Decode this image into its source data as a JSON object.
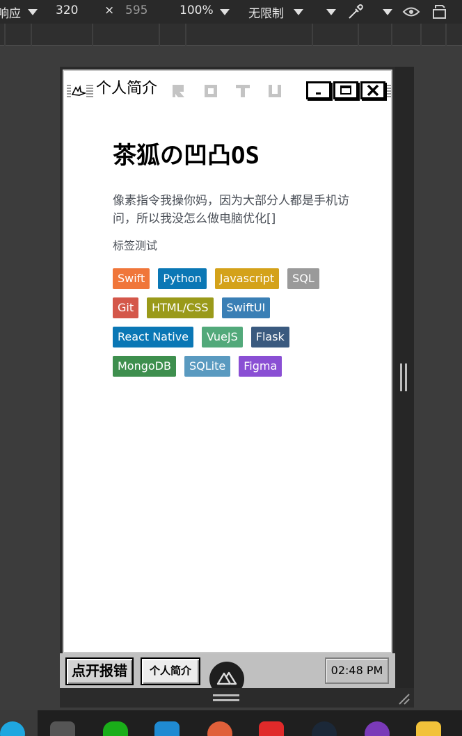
{
  "devtools": {
    "responsive_label": "响应",
    "width": "320",
    "times": "×",
    "height": "595",
    "zoom": "100%",
    "throttle": "无限制"
  },
  "window": {
    "title": "个人简介",
    "ghost_icons": [
      "R",
      "O",
      "T",
      "U"
    ]
  },
  "content": {
    "heading": "茶狐の凹凸OS",
    "description": "像素指令我操你妈，因为大部分人都是手机访问，所以我没怎么做电脑优化[]",
    "tags_label": "标签测试",
    "tags": [
      {
        "label": "Swift",
        "color": "#f0763a"
      },
      {
        "label": "Python",
        "color": "#0a77b5"
      },
      {
        "label": "Javascript",
        "color": "#d4a21a"
      },
      {
        "label": "SQL",
        "color": "#9a9a9a"
      },
      {
        "label": "Git",
        "color": "#d4574a"
      },
      {
        "label": "HTML/CSS",
        "color": "#9a9a1a"
      },
      {
        "label": "SwiftUI",
        "color": "#3a7fb5"
      },
      {
        "label": "React Native",
        "color": "#0a77b5"
      },
      {
        "label": "VueJS",
        "color": "#52a97a"
      },
      {
        "label": "Flask",
        "color": "#3a5a7f"
      },
      {
        "label": "MongoDB",
        "color": "#3e8f4e"
      },
      {
        "label": "SQLite",
        "color": "#5a9ac0"
      },
      {
        "label": "Figma",
        "color": "#8a4fd4"
      }
    ]
  },
  "taskbar": {
    "bug_button": "点开报错",
    "active_window": "个人简介",
    "clock": "02:48 PM"
  }
}
